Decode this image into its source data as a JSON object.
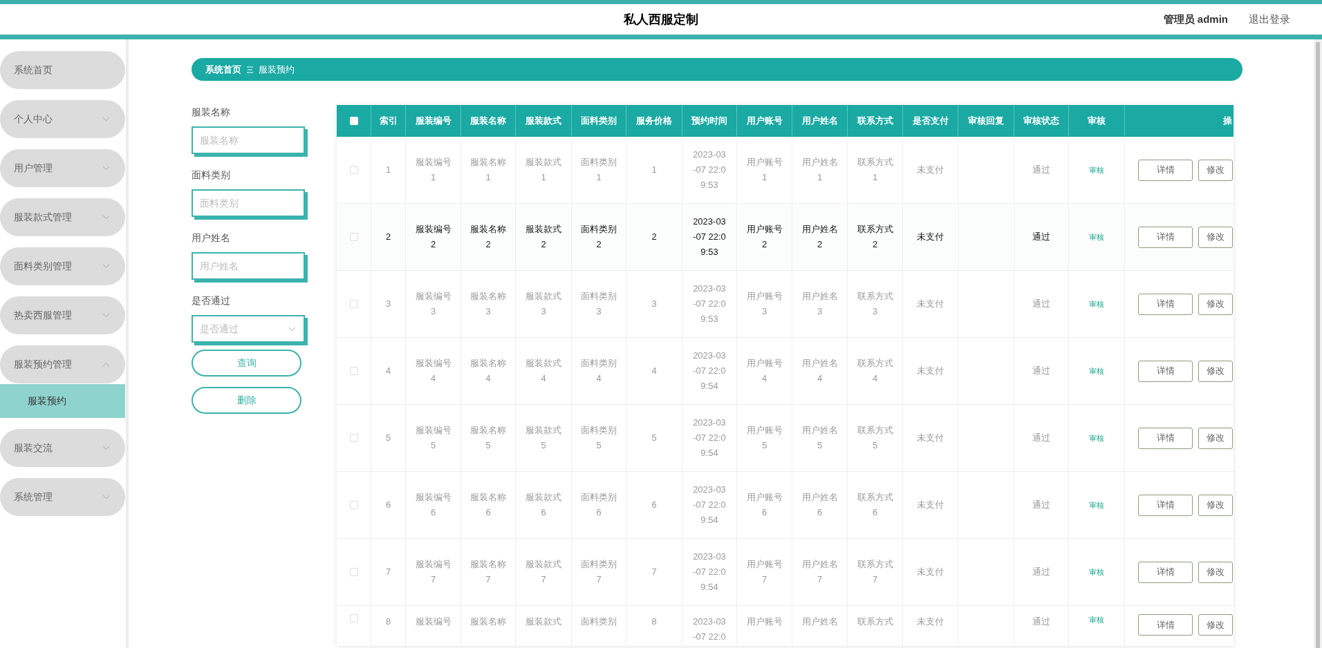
{
  "header": {
    "title": "私人西服定制",
    "user": "管理员 admin",
    "logout": "退出登录"
  },
  "sidebar": {
    "items": [
      {
        "label": "系统首页"
      },
      {
        "label": "个人中心",
        "expanded": false
      },
      {
        "label": "用户管理",
        "expanded": false
      },
      {
        "label": "服装款式管理",
        "expanded": false
      },
      {
        "label": "面料类别管理",
        "expanded": false
      },
      {
        "label": "热卖西服管理",
        "expanded": false
      },
      {
        "label": "服装预约管理",
        "expanded": true,
        "children": [
          {
            "label": "服装预约",
            "selected": true
          }
        ]
      },
      {
        "label": "服装交流",
        "expanded": false
      },
      {
        "label": "系统管理",
        "expanded": false
      }
    ]
  },
  "breadcrumb": [
    "系统首页",
    "服装预约"
  ],
  "filters": [
    {
      "label": "服装名称",
      "placeholder": "服装名称",
      "kind": "input"
    },
    {
      "label": "面料类别",
      "placeholder": "面料类别",
      "kind": "input"
    },
    {
      "label": "用户姓名",
      "placeholder": "用户姓名",
      "kind": "input"
    },
    {
      "label": "是否通过",
      "placeholder": "是否通过",
      "kind": "select"
    }
  ],
  "filter_buttons": [
    "查询",
    "删除"
  ],
  "table": {
    "select_all": {
      "checked": false
    },
    "columns": [
      "索引",
      "服装编号",
      "服装名称",
      "服装款式",
      "面料类别",
      "服务价格",
      "预约时间",
      "用户账号",
      "用户姓名",
      "联系方式",
      "是否支付",
      "审核回复",
      "审核状态",
      "审核",
      "操"
    ],
    "rows": [
      {
        "checked": false,
        "highlighted": false,
        "cells": [
          "1",
          "服装编号1",
          "服装名称1",
          "服装款式1",
          "面料类别1",
          "1",
          "2023-03-07 22:09:53",
          "用户账号1",
          "用户姓名1",
          "联系方式1",
          "未支付",
          "",
          "通过"
        ],
        "review": "审核",
        "actions": [
          "详情",
          "修改"
        ]
      },
      {
        "checked": false,
        "highlighted": true,
        "cells": [
          "2",
          "服装编号2",
          "服装名称2",
          "服装款式2",
          "面料类别2",
          "2",
          "2023-03-07 22:09:53",
          "用户账号2",
          "用户姓名2",
          "联系方式2",
          "未支付",
          "",
          "通过"
        ],
        "review": "审核",
        "actions": [
          "详情",
          "修改"
        ]
      },
      {
        "checked": false,
        "highlighted": false,
        "cells": [
          "3",
          "服装编号3",
          "服装名称3",
          "服装款式3",
          "面料类别3",
          "3",
          "2023-03-07 22:09:53",
          "用户账号3",
          "用户姓名3",
          "联系方式3",
          "未支付",
          "",
          "通过"
        ],
        "review": "审核",
        "actions": [
          "详情",
          "修改"
        ]
      },
      {
        "checked": false,
        "highlighted": false,
        "cells": [
          "4",
          "服装编号4",
          "服装名称4",
          "服装款式4",
          "面料类别4",
          "4",
          "2023-03-07 22:09:54",
          "用户账号4",
          "用户姓名4",
          "联系方式4",
          "未支付",
          "",
          "通过"
        ],
        "review": "审核",
        "actions": [
          "详情",
          "修改"
        ]
      },
      {
        "checked": false,
        "highlighted": false,
        "cells": [
          "5",
          "服装编号5",
          "服装名称5",
          "服装款式5",
          "面料类别5",
          "5",
          "2023-03-07 22:09:54",
          "用户账号5",
          "用户姓名5",
          "联系方式5",
          "未支付",
          "",
          "通过"
        ],
        "review": "审核",
        "actions": [
          "详情",
          "修改"
        ]
      },
      {
        "checked": false,
        "highlighted": false,
        "cells": [
          "6",
          "服装编号6",
          "服装名称6",
          "服装款式6",
          "面料类别6",
          "6",
          "2023-03-07 22:09:54",
          "用户账号6",
          "用户姓名6",
          "联系方式6",
          "未支付",
          "",
          "通过"
        ],
        "review": "审核",
        "actions": [
          "详情",
          "修改"
        ]
      },
      {
        "checked": false,
        "highlighted": false,
        "cells": [
          "7",
          "服装编号7",
          "服装名称7",
          "服装款式7",
          "面料类别7",
          "7",
          "2023-03-07 22:09:54",
          "用户账号7",
          "用户姓名7",
          "联系方式7",
          "未支付",
          "",
          "通过"
        ],
        "review": "审核",
        "actions": [
          "详情",
          "修改"
        ]
      },
      {
        "checked": false,
        "highlighted": false,
        "cells": [
          "8",
          "服装编号",
          "服装名称",
          "服装款式",
          "面料类别",
          "8",
          "2023-03-07 22:0",
          "用户账号",
          "用户姓名",
          "联系方式",
          "未支付",
          "",
          "通过"
        ],
        "review": "审核",
        "actions": [
          "详情",
          "修改"
        ]
      }
    ]
  }
}
